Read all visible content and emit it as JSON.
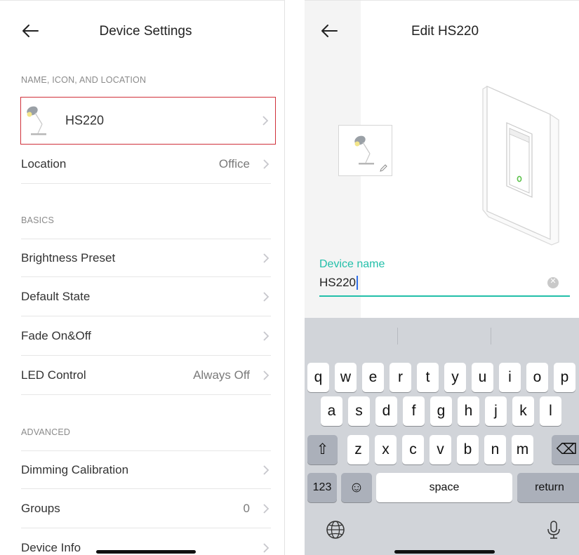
{
  "left": {
    "title": "Device Settings",
    "sections": {
      "name_icon_location": "NAME, ICON, AND LOCATION",
      "basics": "BASICS",
      "advanced": "ADVANCED"
    },
    "device_name": "HS220",
    "rows": {
      "location": {
        "label": "Location",
        "value": "Office"
      },
      "brightness_preset": {
        "label": "Brightness Preset"
      },
      "default_state": {
        "label": "Default State"
      },
      "fade": {
        "label": "Fade On&Off"
      },
      "led_control": {
        "label": "LED Control",
        "value": "Always Off"
      },
      "dimming_calibration": {
        "label": "Dimming Calibration"
      },
      "groups": {
        "label": "Groups",
        "value": "0"
      },
      "device_info": {
        "label": "Device Info"
      }
    },
    "highlight_color": "#d0303a"
  },
  "right": {
    "title": "Edit HS220",
    "field_label": "Device name",
    "field_value": "HS220",
    "accent_color": "#22bfa9",
    "keyboard": {
      "row1": [
        "q",
        "w",
        "e",
        "r",
        "t",
        "y",
        "u",
        "i",
        "o",
        "p"
      ],
      "row2": [
        "a",
        "s",
        "d",
        "f",
        "g",
        "h",
        "j",
        "k",
        "l"
      ],
      "row3": [
        "z",
        "x",
        "c",
        "v",
        "b",
        "n",
        "m"
      ],
      "shift_glyph": "⇧",
      "delete_glyph": "⌫",
      "numbers_label": "123",
      "emoji_glyph": "☺",
      "space_label": "space",
      "return_label": "return"
    }
  },
  "icons": [
    "back-arrow-icon",
    "chevron-right-icon",
    "lamp-icon",
    "pencil-icon",
    "clear-icon",
    "globe-icon",
    "microphone-icon",
    "shift-icon",
    "delete-icon",
    "emoji-icon"
  ]
}
